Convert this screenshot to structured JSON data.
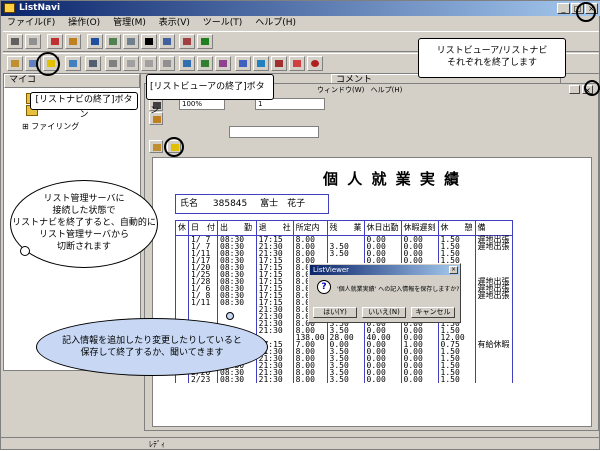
{
  "window": {
    "title": "ListNavi"
  },
  "menu": [
    "ファイル(F)",
    "操作(O)",
    "管理(M)",
    "表示(V)",
    "ツール(T)",
    "ヘルプ(H)"
  ],
  "tree": {
    "header_left": "マイコ",
    "header_right": "コメント",
    "items": [
      "ファイリング"
    ]
  },
  "inner": {
    "menu": [
      "ウィンドウ(W)",
      "ヘルプ(H)"
    ],
    "zoom": "100%",
    "page": "1"
  },
  "report": {
    "title": "個 人 就 業 実 績",
    "name_label": "氏名",
    "employee_id": "385845",
    "employee_name": "富士　花子",
    "columns": [
      "休",
      "日　付",
      "出　　勤",
      "退　　社",
      "所定内",
      "残　　業",
      "休日出勤",
      "休暇遅刻",
      "休　　憩",
      "備"
    ],
    "group1": {
      "dates": [
        "1/ 7",
        "1/ 7",
        "1/11",
        "1/17",
        "1/20",
        "1/25",
        "1/28",
        "1/ 6",
        "1/ 8",
        "1/11"
      ],
      "in": [
        "08:30",
        "08:30",
        "08:30",
        "08:30",
        "08:30",
        "08:30",
        "08:30",
        "08:30",
        "08:30",
        "08:30"
      ],
      "out": [
        "17:15",
        "21:30",
        "21:30",
        "17:15",
        "17:15",
        "17:15",
        "17:15",
        "17:15",
        "17:15",
        "17:15"
      ],
      "regular": [
        "8.00",
        "8.00",
        "8.00",
        "8.00",
        "8.00",
        "8.00",
        "8.00",
        "8.00",
        "8.00",
        "8.00"
      ],
      "ot": [
        "",
        "3.50",
        "3.50",
        "",
        "",
        "",
        "",
        "",
        "",
        ""
      ],
      "hol": [
        "0.00",
        "0.00",
        "0.00",
        "0.00",
        "0.00",
        "0.00",
        "0.00",
        "0.00",
        "0.00",
        "0.00"
      ],
      "leave": [
        "0.00",
        "0.00",
        "0.00",
        "0.00",
        "0.00",
        "0.00",
        "0.00",
        "0.00",
        "0.00",
        "0.00"
      ],
      "rest": [
        "1.50",
        "1.50",
        "1.50",
        "1.50",
        "1.00",
        "1.50",
        "1.50",
        "1.50",
        "1.50",
        "1.50"
      ],
      "note": [
        "遅地出張",
        "遅地出張",
        "",
        "",
        "",
        "",
        "遅地出張",
        "遅地出張",
        "遅地出張",
        ""
      ]
    },
    "group2": {
      "out": [
        "21:30",
        "21:30",
        "21:30",
        "21:30"
      ],
      "regular": [
        "8.00",
        "8.00",
        "8.00",
        "8.00"
      ],
      "ot": [
        "3.50",
        "3.50",
        "3.50",
        "3.50"
      ],
      "hol": [
        "0.00",
        "0.00",
        "0.00",
        "0.00"
      ],
      "leave": [
        "0.00",
        "0.00",
        "0.00",
        "0.00"
      ],
      "rest": [
        "1.50",
        "1.50",
        "1.50",
        "1.50"
      ]
    },
    "total": {
      "label": "月 合 計",
      "regular": "138.00",
      "ot": "28.00",
      "hol": "40.00",
      "leave": "0.00",
      "rest": "12.00"
    },
    "group3": {
      "kyu": "休",
      "dates": [
        "2/ 2",
        "2/ 7",
        "2/10",
        "2/17",
        "2/20",
        "2/23"
      ],
      "in": [
        "08:30",
        "08:30",
        "08:30",
        "08:30",
        "08:30",
        "08:30"
      ],
      "out": [
        "17:15",
        "21:30",
        "21:30",
        "21:30",
        "21:30",
        "21:30"
      ],
      "regular": [
        "7.00",
        "8.00",
        "8.00",
        "8.00",
        "8.00",
        "8.00"
      ],
      "ot": [
        "0.00",
        "3.50",
        "3.50",
        "3.50",
        "3.50",
        "3.50"
      ],
      "hol": [
        "0.00",
        "0.00",
        "0.00",
        "0.00",
        "0.00",
        "0.00"
      ],
      "leave": [
        "1.00",
        "0.00",
        "0.00",
        "0.00",
        "0.00",
        "0.00"
      ],
      "rest": [
        "0.75",
        "1.50",
        "1.50",
        "1.50",
        "1.50",
        "1.50"
      ],
      "note": [
        "有給休暇",
        "",
        "",
        "",
        "",
        ""
      ]
    }
  },
  "dialog": {
    "title": "ListViewer",
    "message": "'個人就業実績' への記入情報を保存しますか?",
    "yes": "はい(Y)",
    "no": "いいえ(N)",
    "cancel": "キャンセル",
    "icon": "question-icon"
  },
  "status": {
    "text": "ﾚﾃﾞｨ"
  },
  "callouts": {
    "navi_exit": "[リストナビの終了]ボタン",
    "viewer_exit": "[リストビューアの終了]ボタン",
    "both_exit_1": "リストビューア/リストナビ",
    "both_exit_2": "それぞれを終了します",
    "server_1": "リスト管理サーバに",
    "server_2": "接続した状態で",
    "server_3": "リストナビを終了すると、自動的に",
    "server_4": "リスト管理サーバから",
    "server_5": "切断されます",
    "save_1": "記入情報を追加したり変更したりしていると",
    "save_2": "保存して終了するか、聞いてきます"
  }
}
